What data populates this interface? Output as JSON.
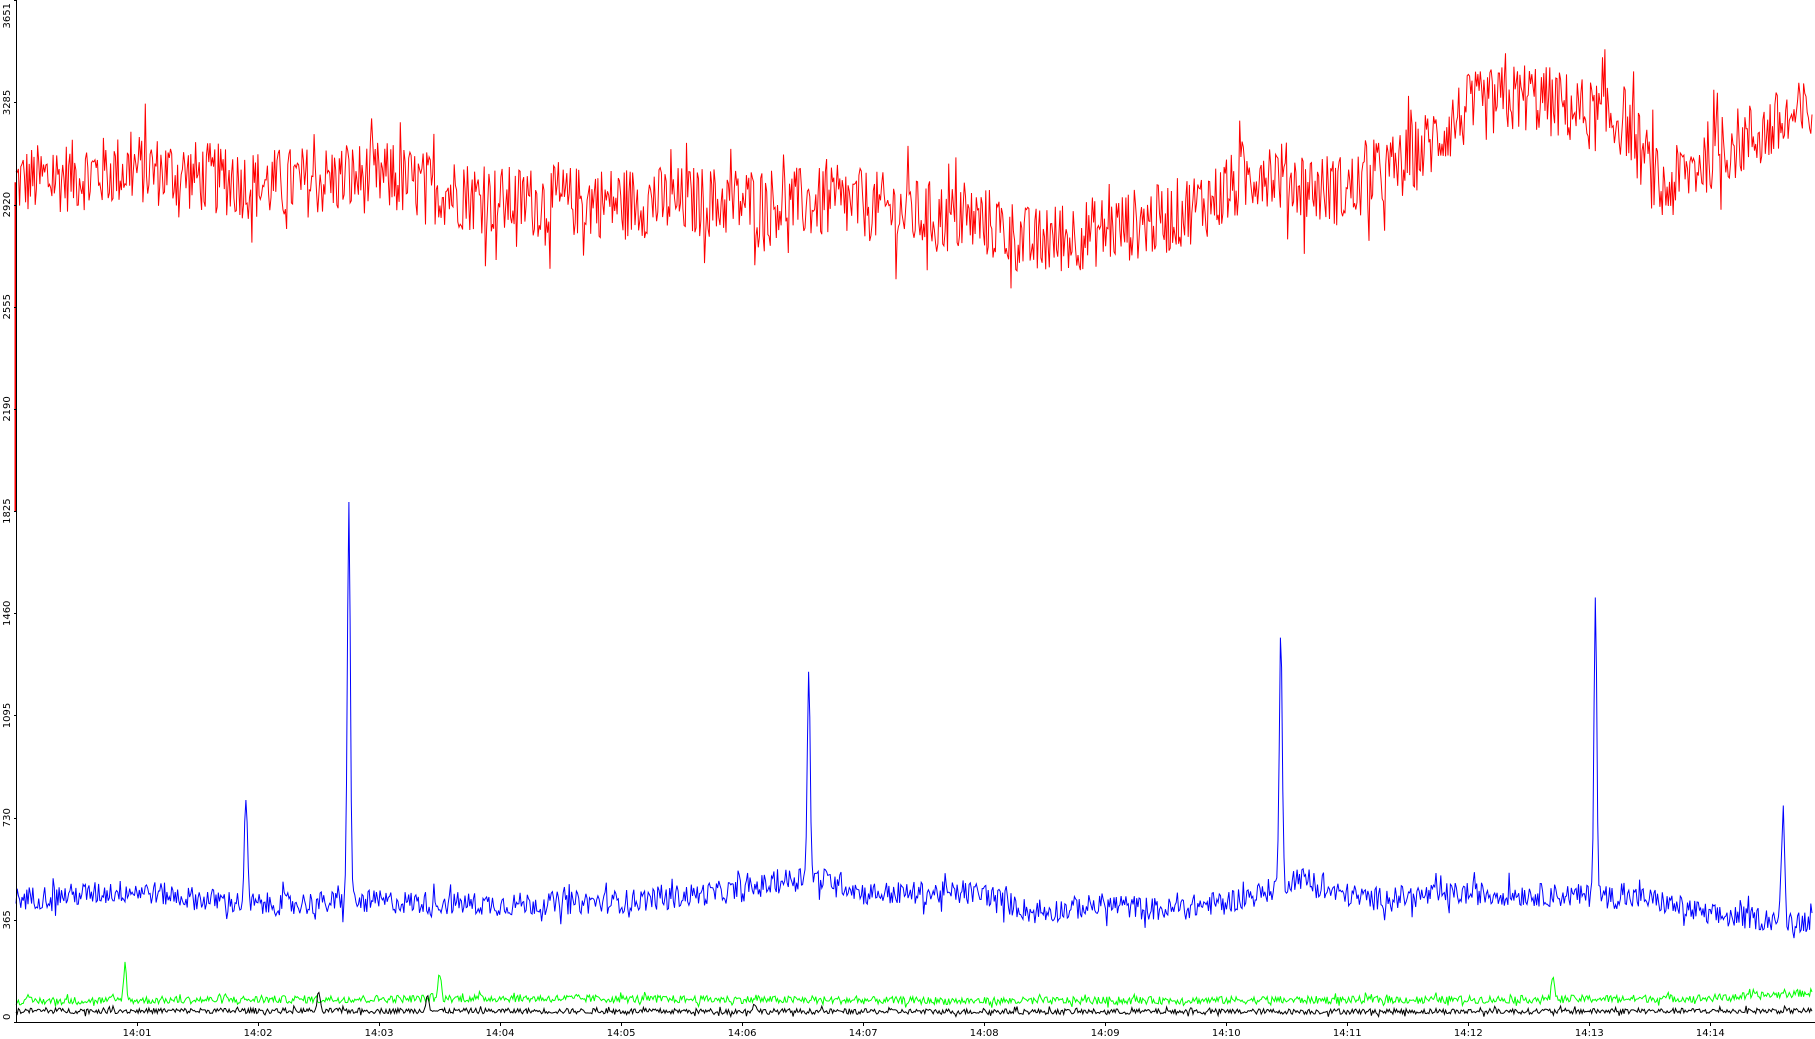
{
  "chart_data": {
    "type": "line",
    "title": "",
    "xlabel": "",
    "ylabel": "",
    "ylim": [
      0,
      3651
    ],
    "xlim_minutes": [
      0,
      14.84
    ],
    "y_ticks": [
      "0",
      "365",
      "730",
      "1095",
      "1460",
      "1825",
      "2190",
      "2555",
      "2920",
      "3285",
      "3651"
    ],
    "y_tick_values": [
      0,
      365,
      730,
      1095,
      1460,
      1825,
      2190,
      2555,
      2920,
      3285,
      3651
    ],
    "x_ticks": [
      "14:01",
      "14:02",
      "14:03",
      "14:04",
      "14:05",
      "14:06",
      "14:07",
      "14:08",
      "14:09",
      "14:10",
      "14:11",
      "14:12",
      "14:13",
      "14:14"
    ],
    "x_tick_minutes": [
      1,
      2,
      3,
      4,
      5,
      6,
      7,
      8,
      9,
      10,
      11,
      12,
      13,
      14
    ],
    "grid": false,
    "legend": "none",
    "series": [
      {
        "key": "red",
        "color": "#ff0000",
        "noise": 130,
        "points": [
          [
            0,
            3000
          ],
          [
            1,
            3050
          ],
          [
            1.5,
            3020
          ],
          [
            2,
            2990
          ],
          [
            3,
            3020
          ],
          [
            4,
            2930
          ],
          [
            5,
            2930
          ],
          [
            6,
            2930
          ],
          [
            7,
            2920
          ],
          [
            7.5,
            2880
          ],
          [
            8,
            2860
          ],
          [
            8.4,
            2780
          ],
          [
            9,
            2830
          ],
          [
            9.5,
            2870
          ],
          [
            10,
            2960
          ],
          [
            10.3,
            3050
          ],
          [
            10.7,
            2980
          ],
          [
            11,
            2970
          ],
          [
            11.5,
            3070
          ],
          [
            12,
            3260
          ],
          [
            12.5,
            3310
          ],
          [
            13,
            3240
          ],
          [
            13.3,
            3220
          ],
          [
            13.6,
            2960
          ],
          [
            14,
            3100
          ],
          [
            14.84,
            3250
          ]
        ],
        "spikes": []
      },
      {
        "key": "blue",
        "color": "#0000ff",
        "noise": 42,
        "points": [
          [
            0,
            440
          ],
          [
            1,
            470
          ],
          [
            1.5,
            440
          ],
          [
            2,
            420
          ],
          [
            3,
            430
          ],
          [
            4,
            420
          ],
          [
            5,
            430
          ],
          [
            5.5,
            450
          ],
          [
            6,
            470
          ],
          [
            6.5,
            520
          ],
          [
            6.8,
            500
          ],
          [
            7,
            460
          ],
          [
            8,
            460
          ],
          [
            8.4,
            390
          ],
          [
            9,
            420
          ],
          [
            9.5,
            400
          ],
          [
            10,
            430
          ],
          [
            10.3,
            460
          ],
          [
            10.6,
            520
          ],
          [
            10.8,
            470
          ],
          [
            11.2,
            440
          ],
          [
            12,
            460
          ],
          [
            13,
            450
          ],
          [
            13.5,
            440
          ],
          [
            14,
            380
          ],
          [
            14.84,
            360
          ]
        ],
        "spikes": [
          [
            1.9,
            790
          ],
          [
            2.75,
            1890
          ],
          [
            6.55,
            1260
          ],
          [
            10.45,
            1380
          ],
          [
            13.05,
            1510
          ],
          [
            14.6,
            760
          ]
        ]
      },
      {
        "key": "green",
        "color": "#00ff00",
        "noise": 14,
        "points": [
          [
            0,
            75
          ],
          [
            2,
            80
          ],
          [
            4,
            85
          ],
          [
            6,
            80
          ],
          [
            8,
            75
          ],
          [
            10,
            78
          ],
          [
            12,
            80
          ],
          [
            14,
            85
          ],
          [
            14.84,
            105
          ]
        ],
        "spikes": [
          [
            0.9,
            205
          ],
          [
            3.5,
            175
          ],
          [
            12.7,
            170
          ],
          [
            14.9,
            160
          ]
        ]
      },
      {
        "key": "black",
        "color": "#000000",
        "noise": 10,
        "points": [
          [
            0,
            40
          ],
          [
            3,
            40
          ],
          [
            6,
            38
          ],
          [
            9,
            37
          ],
          [
            12,
            38
          ],
          [
            14.84,
            40
          ]
        ],
        "spikes": [
          [
            2.5,
            100
          ],
          [
            3.4,
            105
          ],
          [
            6.1,
            70
          ]
        ]
      }
    ]
  }
}
